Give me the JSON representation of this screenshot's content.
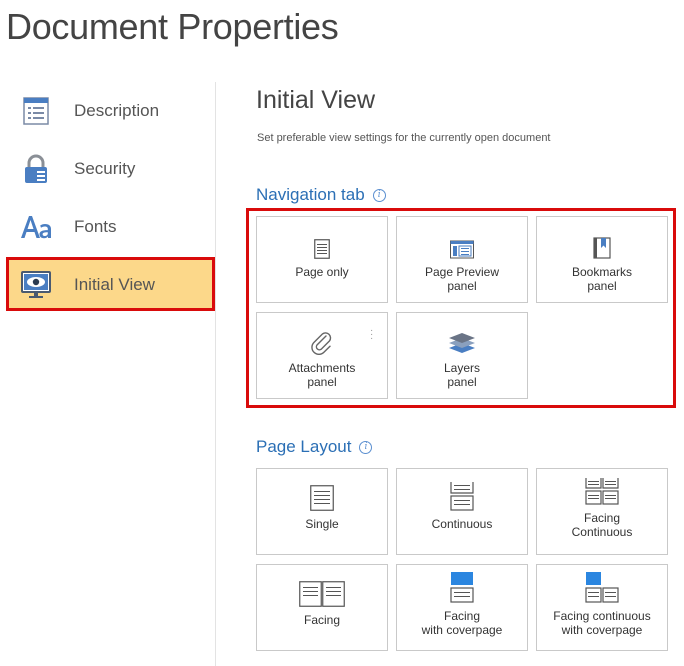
{
  "app": {
    "title": "Document Properties"
  },
  "sidebar": {
    "items": [
      {
        "label": "Description",
        "icon": "list-document-icon"
      },
      {
        "label": "Security",
        "icon": "lock-icon"
      },
      {
        "label": "Fonts",
        "icon": "font-aa-icon"
      },
      {
        "label": "Initial View",
        "icon": "monitor-eye-icon",
        "active": true
      }
    ]
  },
  "main": {
    "title": "Initial View",
    "description": "Set preferable view settings for the currently open document",
    "navigation_tab": {
      "title": "Navigation tab",
      "options": [
        {
          "label": "Page only",
          "icon": "page-icon"
        },
        {
          "label": "Page Preview\npanel",
          "icon": "page-preview-icon"
        },
        {
          "label": "Bookmarks\npanel",
          "icon": "bookmark-icon"
        },
        {
          "label": "Attachments\npanel",
          "icon": "paperclip-icon"
        },
        {
          "label": "Layers\npanel",
          "icon": "layers-icon"
        }
      ]
    },
    "page_layout": {
      "title": "Page Layout",
      "options": [
        {
          "label": "Single",
          "icon": "single-page-icon"
        },
        {
          "label": "Continuous",
          "icon": "continuous-icon"
        },
        {
          "label": "Facing\nContinuous",
          "icon": "facing-continuous-icon"
        },
        {
          "label": "Facing",
          "icon": "facing-icon"
        },
        {
          "label": "Facing\nwith coverpage",
          "icon": "facing-coverpage-icon"
        },
        {
          "label": "Facing continuous\nwith coverpage",
          "icon": "facing-continuous-coverpage-icon"
        }
      ]
    }
  },
  "colors": {
    "accent": "#2b6fb5",
    "active_bg": "#fcd88a",
    "highlight": "#d90b0b"
  }
}
